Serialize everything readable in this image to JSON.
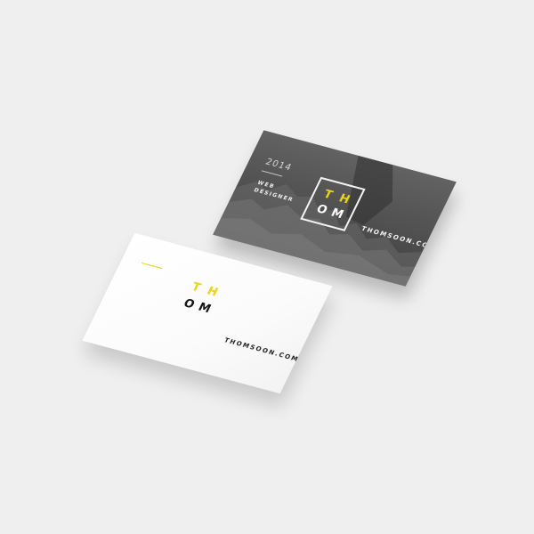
{
  "scene": {
    "background_color": "#efefef"
  },
  "dark_card": {
    "year": "2014",
    "role_line1": "WEB",
    "role_line2": "DESIGNER",
    "logo": {
      "top_left": "T",
      "top_right": "H",
      "bottom_left": "O",
      "bottom_right": "M"
    },
    "url": "THOMSOON.COM",
    "accent_color": "#e8d21d",
    "background_color": "#4a4a4a"
  },
  "white_card": {
    "logo": {
      "top_left": "T",
      "top_right": "H",
      "bottom_left": "O",
      "bottom_right": "M"
    },
    "url": "THOMSOON.COM",
    "accent_color": "#e8d21d",
    "text_color": "#151515"
  }
}
